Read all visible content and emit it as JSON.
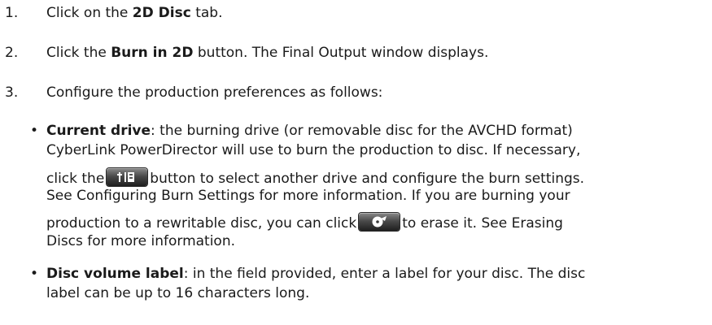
{
  "steps": [
    {
      "num": "1.",
      "pre": "Click on the ",
      "bold": "2D Disc",
      "post": " tab."
    },
    {
      "num": "2.",
      "pre": "Click the ",
      "bold": "Burn in 2D",
      "post": " button. The Final Output window displays."
    },
    {
      "num": "3.",
      "text": "Configure the production preferences as follows:"
    }
  ],
  "current_drive": {
    "term": "Current drive",
    "line1": ": the burning drive (or removable disc for the AVCHD format)",
    "line2": "CyberLink PowerDirector will use to burn the production to disc. If necessary,",
    "line3_pre": "click the",
    "line3_post": "button to select another drive and configure the burn settings.",
    "line4": "See Configuring Burn Settings for more information. If you are burning your",
    "line5_pre": "production to a rewritable disc, you can click",
    "line5_post": "to erase it. See Erasing",
    "line6": "Discs for more information.",
    "settings_icon": "drive-settings-icon",
    "erase_icon": "erase-disc-icon"
  },
  "disc_volume": {
    "term": "Disc volume label",
    "line1": ": in the field provided, enter a label for your disc. The disc",
    "line2": "label can be up to 16 characters long."
  },
  "bullet_glyph": "•"
}
